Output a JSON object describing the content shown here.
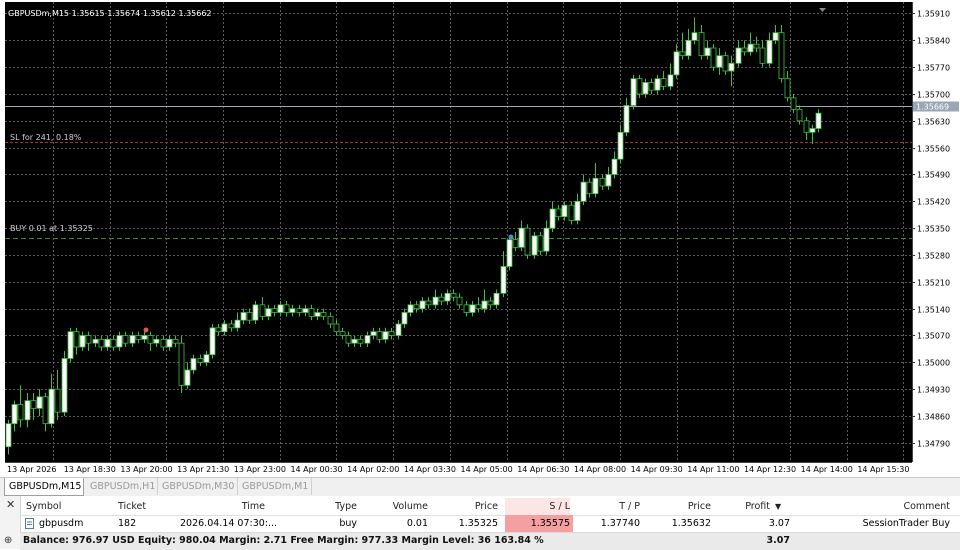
{
  "chart": {
    "header": "GBPUSDm,M15  1.35615 1.35674 1.35612 1.35662",
    "current_price": "1.35669",
    "sl_label": "SL for 241, 0.18%",
    "buy_label": "BUY 0.01 at 1.35325",
    "colors": {
      "background": "#000000",
      "grid": "#5a5a5a",
      "bull": "#ffffff",
      "bear": "#000000",
      "wick": "#3fbf3f",
      "sl_line": "#b03030",
      "buy_line": "#2e8b2e",
      "price_line": "#9aa5b5"
    }
  },
  "chart_data": {
    "type": "candlestick",
    "symbol": "GBPUSDm",
    "timeframe": "M15",
    "ylim": [
      1.3474,
      1.3594
    ],
    "y_ticks": [
      "1.35910",
      "1.35840",
      "1.35770",
      "1.35700",
      "1.35630",
      "1.35560",
      "1.35490",
      "1.35420",
      "1.35350",
      "1.35280",
      "1.35210",
      "1.35140",
      "1.35070",
      "1.35000",
      "1.34930",
      "1.34860",
      "1.34790"
    ],
    "x_ticks": [
      "13 Apr 2026",
      "13 Apr 18:30",
      "13 Apr 20:00",
      "13 Apr 21:30",
      "13 Apr 23:00",
      "14 Apr 00:30",
      "14 Apr 02:00",
      "14 Apr 03:30",
      "14 Apr 05:00",
      "14 Apr 06:30",
      "14 Apr 08:00",
      "14 Apr 09:30",
      "14 Apr 11:00",
      "14 Apr 12:30",
      "14 Apr 14:00",
      "14 Apr 15:30"
    ],
    "current_price": 1.35669,
    "sl_price": 1.35575,
    "entry_price": 1.35325,
    "candles": [
      [
        1.3478,
        1.3484,
        1.3476,
        1.3485
      ],
      [
        1.3484,
        1.3489,
        1.3482,
        1.349
      ],
      [
        1.3489,
        1.3485,
        1.3483,
        1.3494
      ],
      [
        1.3485,
        1.349,
        1.3483,
        1.3492
      ],
      [
        1.349,
        1.3488,
        1.3485,
        1.3492
      ],
      [
        1.3488,
        1.3491,
        1.3486,
        1.3493
      ],
      [
        1.3491,
        1.3484,
        1.3482,
        1.3492
      ],
      [
        1.3484,
        1.3493,
        1.3483,
        1.3497
      ],
      [
        1.3493,
        1.3487,
        1.3485,
        1.3498
      ],
      [
        1.3487,
        1.3501,
        1.3486,
        1.3503
      ],
      [
        1.3501,
        1.3508,
        1.35,
        1.3509
      ],
      [
        1.3508,
        1.3504,
        1.3502,
        1.3509
      ],
      [
        1.3504,
        1.3507,
        1.3503,
        1.3508
      ],
      [
        1.3507,
        1.3505,
        1.3503,
        1.3508
      ],
      [
        1.3505,
        1.3506,
        1.3504,
        1.3507
      ],
      [
        1.3506,
        1.3504,
        1.3503,
        1.3507
      ],
      [
        1.3504,
        1.3506,
        1.3503,
        1.3507
      ],
      [
        1.3506,
        1.3504,
        1.3503,
        1.3507
      ],
      [
        1.3504,
        1.3507,
        1.3503,
        1.3508
      ],
      [
        1.3507,
        1.3505,
        1.3504,
        1.3508
      ],
      [
        1.3505,
        1.3507,
        1.3504,
        1.3508
      ],
      [
        1.3507,
        1.3506,
        1.3505,
        1.3508
      ],
      [
        1.3506,
        1.3507,
        1.3505,
        1.3508
      ],
      [
        1.3507,
        1.3505,
        1.3503,
        1.3508
      ],
      [
        1.3505,
        1.3506,
        1.3504,
        1.3507
      ],
      [
        1.3506,
        1.3504,
        1.3503,
        1.3507
      ],
      [
        1.3504,
        1.3506,
        1.3503,
        1.3507
      ],
      [
        1.3506,
        1.3505,
        1.3504,
        1.3507
      ],
      [
        1.3505,
        1.3494,
        1.3492,
        1.3507
      ],
      [
        1.3494,
        1.3498,
        1.3493,
        1.35
      ],
      [
        1.3498,
        1.3501,
        1.3497,
        1.3502
      ],
      [
        1.3501,
        1.35,
        1.3499,
        1.3502
      ],
      [
        1.35,
        1.3502,
        1.3499,
        1.3503
      ],
      [
        1.3502,
        1.3509,
        1.3501,
        1.351
      ],
      [
        1.3509,
        1.3508,
        1.3507,
        1.351
      ],
      [
        1.3508,
        1.351,
        1.3507,
        1.3511
      ],
      [
        1.351,
        1.3509,
        1.3508,
        1.3511
      ],
      [
        1.3509,
        1.3511,
        1.3508,
        1.3513
      ],
      [
        1.3511,
        1.3513,
        1.351,
        1.3514
      ],
      [
        1.3513,
        1.3511,
        1.351,
        1.3514
      ],
      [
        1.3511,
        1.3515,
        1.351,
        1.3516
      ],
      [
        1.3515,
        1.3512,
        1.3511,
        1.3517
      ],
      [
        1.3512,
        1.3514,
        1.3511,
        1.3515
      ],
      [
        1.3514,
        1.3513,
        1.3512,
        1.3515
      ],
      [
        1.3513,
        1.3515,
        1.3512,
        1.3516
      ],
      [
        1.3515,
        1.3513,
        1.3512,
        1.3516
      ],
      [
        1.3513,
        1.3514,
        1.3512,
        1.3515
      ],
      [
        1.3514,
        1.3513,
        1.3512,
        1.3515
      ],
      [
        1.3513,
        1.3514,
        1.3512,
        1.3515
      ],
      [
        1.3514,
        1.3512,
        1.3511,
        1.3515
      ],
      [
        1.3512,
        1.3513,
        1.3511,
        1.3514
      ],
      [
        1.3513,
        1.3512,
        1.3511,
        1.3514
      ],
      [
        1.3512,
        1.351,
        1.3509,
        1.3513
      ],
      [
        1.351,
        1.3508,
        1.3507,
        1.3511
      ],
      [
        1.3508,
        1.3507,
        1.3506,
        1.3509
      ],
      [
        1.3507,
        1.3505,
        1.3504,
        1.3508
      ],
      [
        1.3505,
        1.3506,
        1.3504,
        1.3507
      ],
      [
        1.3506,
        1.3505,
        1.3504,
        1.3507
      ],
      [
        1.3505,
        1.3507,
        1.3504,
        1.3508
      ],
      [
        1.3507,
        1.3508,
        1.3506,
        1.3509
      ],
      [
        1.3508,
        1.3506,
        1.3505,
        1.3509
      ],
      [
        1.3506,
        1.3508,
        1.3505,
        1.3509
      ],
      [
        1.3508,
        1.3507,
        1.3506,
        1.3509
      ],
      [
        1.3507,
        1.351,
        1.3506,
        1.3511
      ],
      [
        1.351,
        1.3513,
        1.3509,
        1.3514
      ],
      [
        1.3513,
        1.3515,
        1.3512,
        1.3516
      ],
      [
        1.3515,
        1.3514,
        1.3513,
        1.3516
      ],
      [
        1.3514,
        1.3516,
        1.3513,
        1.3517
      ],
      [
        1.3516,
        1.3515,
        1.3514,
        1.3517
      ],
      [
        1.3515,
        1.3517,
        1.3514,
        1.3519
      ],
      [
        1.3517,
        1.3516,
        1.3515,
        1.3518
      ],
      [
        1.3516,
        1.3518,
        1.3515,
        1.3519
      ],
      [
        1.3518,
        1.3517,
        1.3516,
        1.3519
      ],
      [
        1.3517,
        1.3515,
        1.3514,
        1.3518
      ],
      [
        1.3515,
        1.3513,
        1.3512,
        1.3516
      ],
      [
        1.3513,
        1.3515,
        1.3512,
        1.3516
      ],
      [
        1.3515,
        1.3514,
        1.3513,
        1.3517
      ],
      [
        1.3514,
        1.3516,
        1.3513,
        1.3519
      ],
      [
        1.3516,
        1.3515,
        1.3514,
        1.3517
      ],
      [
        1.3515,
        1.3518,
        1.3514,
        1.3519
      ],
      [
        1.3518,
        1.3525,
        1.3517,
        1.3529
      ],
      [
        1.3525,
        1.3532,
        1.3524,
        1.3533
      ],
      [
        1.3532,
        1.353,
        1.3529,
        1.3534
      ],
      [
        1.353,
        1.3535,
        1.3529,
        1.3537
      ],
      [
        1.3535,
        1.3528,
        1.3527,
        1.3536
      ],
      [
        1.3528,
        1.3533,
        1.3527,
        1.3534
      ],
      [
        1.3533,
        1.3529,
        1.3528,
        1.3534
      ],
      [
        1.3529,
        1.3535,
        1.3528,
        1.3537
      ],
      [
        1.3535,
        1.354,
        1.3534,
        1.3542
      ],
      [
        1.354,
        1.3538,
        1.3537,
        1.3541
      ],
      [
        1.3538,
        1.3541,
        1.3537,
        1.3542
      ],
      [
        1.3541,
        1.3537,
        1.3536,
        1.3542
      ],
      [
        1.3537,
        1.3542,
        1.3536,
        1.3544
      ],
      [
        1.3542,
        1.3547,
        1.3541,
        1.3549
      ],
      [
        1.3547,
        1.3544,
        1.3543,
        1.3548
      ],
      [
        1.3544,
        1.3548,
        1.3543,
        1.3552
      ],
      [
        1.3548,
        1.3546,
        1.3545,
        1.3549
      ],
      [
        1.3546,
        1.3549,
        1.3545,
        1.3551
      ],
      [
        1.3549,
        1.3553,
        1.3548,
        1.3555
      ],
      [
        1.3553,
        1.356,
        1.3552,
        1.3562
      ],
      [
        1.356,
        1.3567,
        1.3559,
        1.3569
      ],
      [
        1.3567,
        1.3574,
        1.3566,
        1.3575
      ],
      [
        1.3574,
        1.357,
        1.3569,
        1.3575
      ],
      [
        1.357,
        1.3573,
        1.3569,
        1.3574
      ],
      [
        1.3573,
        1.3571,
        1.357,
        1.3574
      ],
      [
        1.3571,
        1.3574,
        1.357,
        1.3575
      ],
      [
        1.3574,
        1.3572,
        1.3571,
        1.3576
      ],
      [
        1.3572,
        1.3575,
        1.3571,
        1.3578
      ],
      [
        1.3575,
        1.3581,
        1.3574,
        1.3583
      ],
      [
        1.3581,
        1.358,
        1.3579,
        1.3586
      ],
      [
        1.358,
        1.3584,
        1.3579,
        1.3587
      ],
      [
        1.3584,
        1.3586,
        1.3583,
        1.359
      ],
      [
        1.3586,
        1.358,
        1.3579,
        1.3588
      ],
      [
        1.358,
        1.3582,
        1.3579,
        1.3584
      ],
      [
        1.3582,
        1.3577,
        1.3576,
        1.3583
      ],
      [
        1.3577,
        1.358,
        1.3575,
        1.3582
      ],
      [
        1.358,
        1.3576,
        1.3575,
        1.3581
      ],
      [
        1.3576,
        1.3578,
        1.3572,
        1.358
      ],
      [
        1.3578,
        1.3582,
        1.3577,
        1.3584
      ],
      [
        1.3582,
        1.3581,
        1.358,
        1.3584
      ],
      [
        1.3581,
        1.3583,
        1.358,
        1.3586
      ],
      [
        1.3583,
        1.3582,
        1.3581,
        1.3585
      ],
      [
        1.3582,
        1.3578,
        1.3577,
        1.3584
      ],
      [
        1.3578,
        1.3584,
        1.3577,
        1.3586
      ],
      [
        1.3584,
        1.3586,
        1.3583,
        1.3588
      ],
      [
        1.3586,
        1.3574,
        1.3573,
        1.3588
      ],
      [
        1.3574,
        1.3569,
        1.3568,
        1.3576
      ],
      [
        1.3569,
        1.3566,
        1.3565,
        1.357
      ],
      [
        1.3566,
        1.3563,
        1.3562,
        1.3567
      ],
      [
        1.3563,
        1.356,
        1.3558,
        1.3564
      ],
      [
        1.356,
        1.3561,
        1.3557,
        1.3562
      ],
      [
        1.3561,
        1.3565,
        1.356,
        1.3566
      ]
    ]
  },
  "tabs": [
    {
      "label": "GBPUSDm,M15",
      "active": true
    },
    {
      "label": "GBPUSDm,H1",
      "active": false
    },
    {
      "label": "GBPUSDm,M30",
      "active": false
    },
    {
      "label": "GBPUSDm,M1",
      "active": false
    }
  ],
  "terminal": {
    "close_symbol": "✕",
    "columns": {
      "symbol": "Symbol",
      "ticket": "Ticket",
      "time": "Time",
      "type": "Type",
      "volume": "Volume",
      "price": "Price",
      "sl": "S / L",
      "tp": "T / P",
      "price2": "Price",
      "profit": "Profit",
      "profit_sort": "▼",
      "comment": "Comment"
    },
    "row": {
      "symbol": "gbpusdm",
      "ticket": "182",
      "time": "2026.04.14 07:30:...",
      "type": "buy",
      "volume": "0.01",
      "price": "1.35325",
      "sl": "1.35575",
      "tp": "1.37740",
      "price2": "1.35632",
      "profit": "3.07",
      "comment": "SessionTrader Buy"
    },
    "summary": {
      "text": "Balance: 976.97 USD  Equity: 980.04  Margin: 2.71  Free Margin: 977.33  Margin Level: 36 163.84 %",
      "profit": "3.07"
    }
  }
}
